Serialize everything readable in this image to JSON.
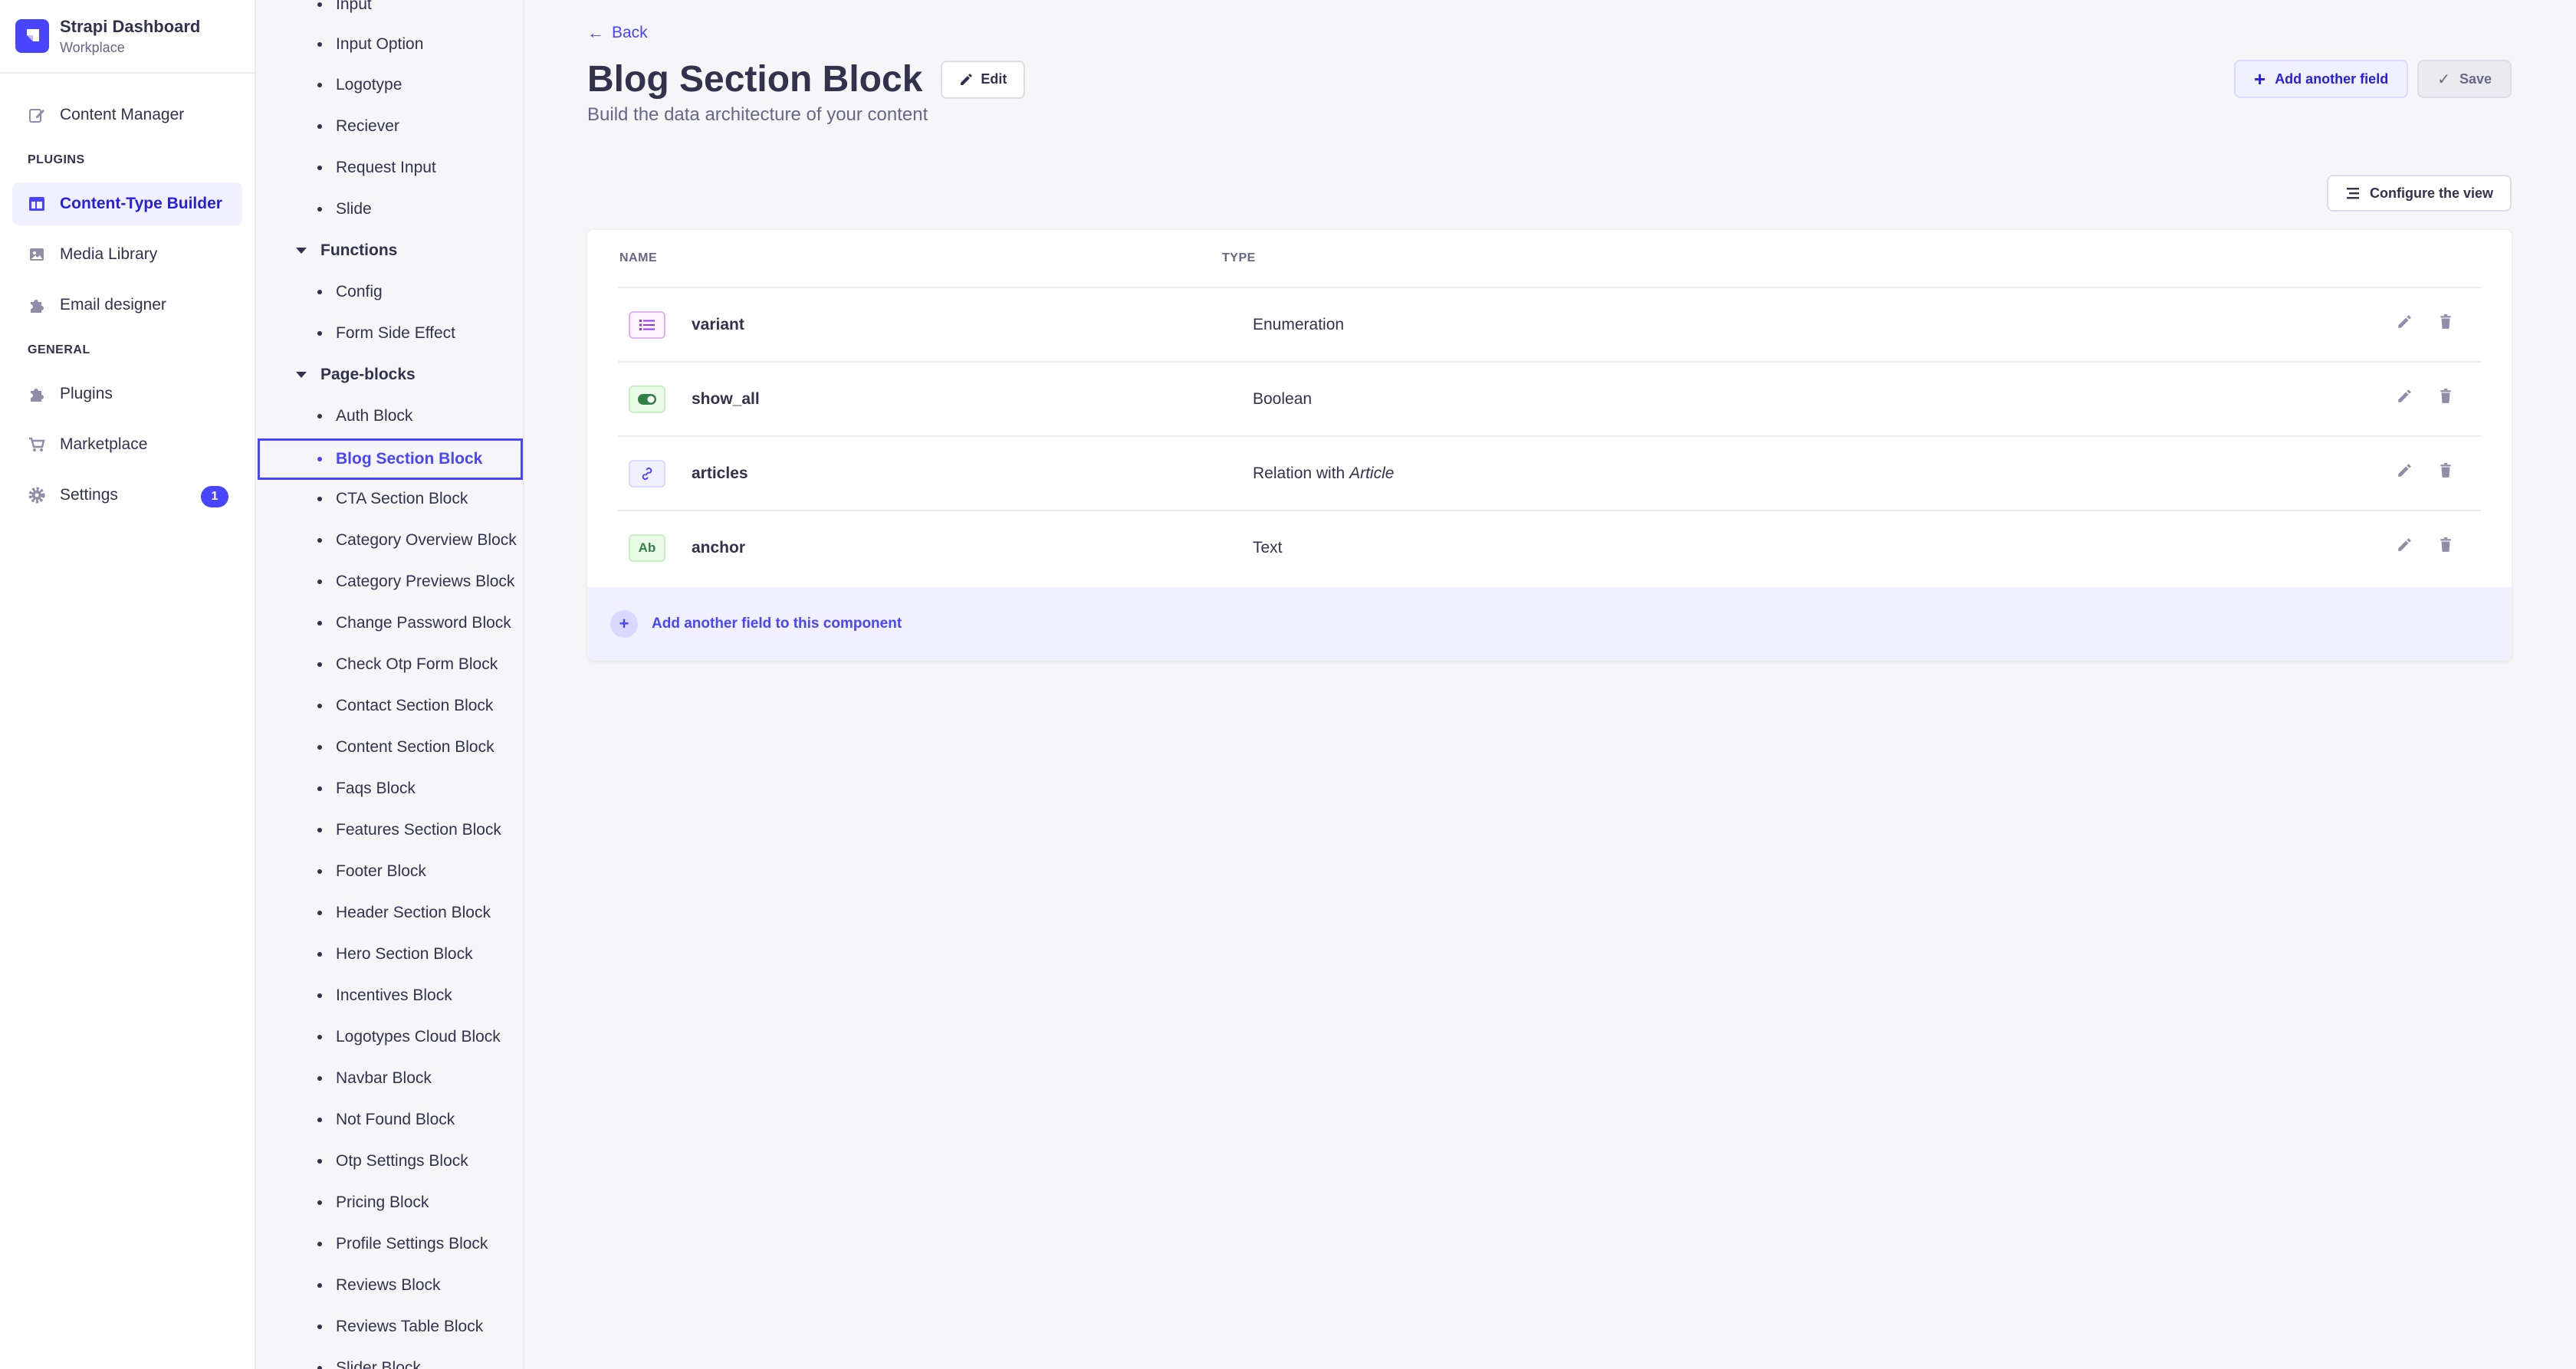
{
  "brand": {
    "title": "Strapi Dashboard",
    "subtitle": "Workplace"
  },
  "mainnav": {
    "content_manager": "Content Manager",
    "plugins_section": "PLUGINS",
    "content_type_builder": "Content-Type Builder",
    "media_library": "Media Library",
    "email_designer": "Email designer",
    "general_section": "GENERAL",
    "plugins": "Plugins",
    "marketplace": "Marketplace",
    "settings": "Settings",
    "settings_badge": "1"
  },
  "subnav": {
    "items_top": [
      "Input",
      "Input Option",
      "Logotype",
      "Reciever",
      "Request Input",
      "Slide"
    ],
    "group_functions": "Functions",
    "items_functions": [
      "Config",
      "Form Side Effect"
    ],
    "group_pageblocks": "Page-blocks",
    "items_pageblocks": [
      "Auth Block",
      "Blog Section Block",
      "CTA Section Block",
      "Category Overview Block",
      "Category Previews Block",
      "Change Password Block",
      "Check Otp Form Block",
      "Contact Section Block",
      "Content Section Block",
      "Faqs Block",
      "Features Section Block",
      "Footer Block",
      "Header Section Block",
      "Hero Section Block",
      "Incentives Block",
      "Logotypes Cloud Block",
      "Navbar Block",
      "Not Found Block",
      "Otp Settings Block",
      "Pricing Block",
      "Profile Settings Block",
      "Reviews Block",
      "Reviews Table Block",
      "Slider Block"
    ]
  },
  "header": {
    "back": "Back",
    "title": "Blog Section Block",
    "edit": "Edit",
    "subtitle": "Build the data architecture of your content",
    "add_field": "Add another field",
    "save": "Save",
    "configure": "Configure the view"
  },
  "table": {
    "col_name": "NAME",
    "col_type": "TYPE",
    "rows": [
      {
        "icon": "enumeration-icon",
        "name": "variant",
        "type": "Enumeration",
        "type_suffix": ""
      },
      {
        "icon": "boolean-icon",
        "name": "show_all",
        "type": "Boolean",
        "type_suffix": ""
      },
      {
        "icon": "relation-icon",
        "name": "articles",
        "type": "Relation with ",
        "type_suffix": "Article"
      },
      {
        "icon": "text-icon",
        "name": "anchor",
        "type": "Text",
        "type_suffix": ""
      }
    ],
    "text_icon_label": "Ab",
    "add_component_field": "Add another field to this component"
  },
  "colors": {
    "accent": "#4945ff",
    "accent_light": "#f0f0ff"
  }
}
